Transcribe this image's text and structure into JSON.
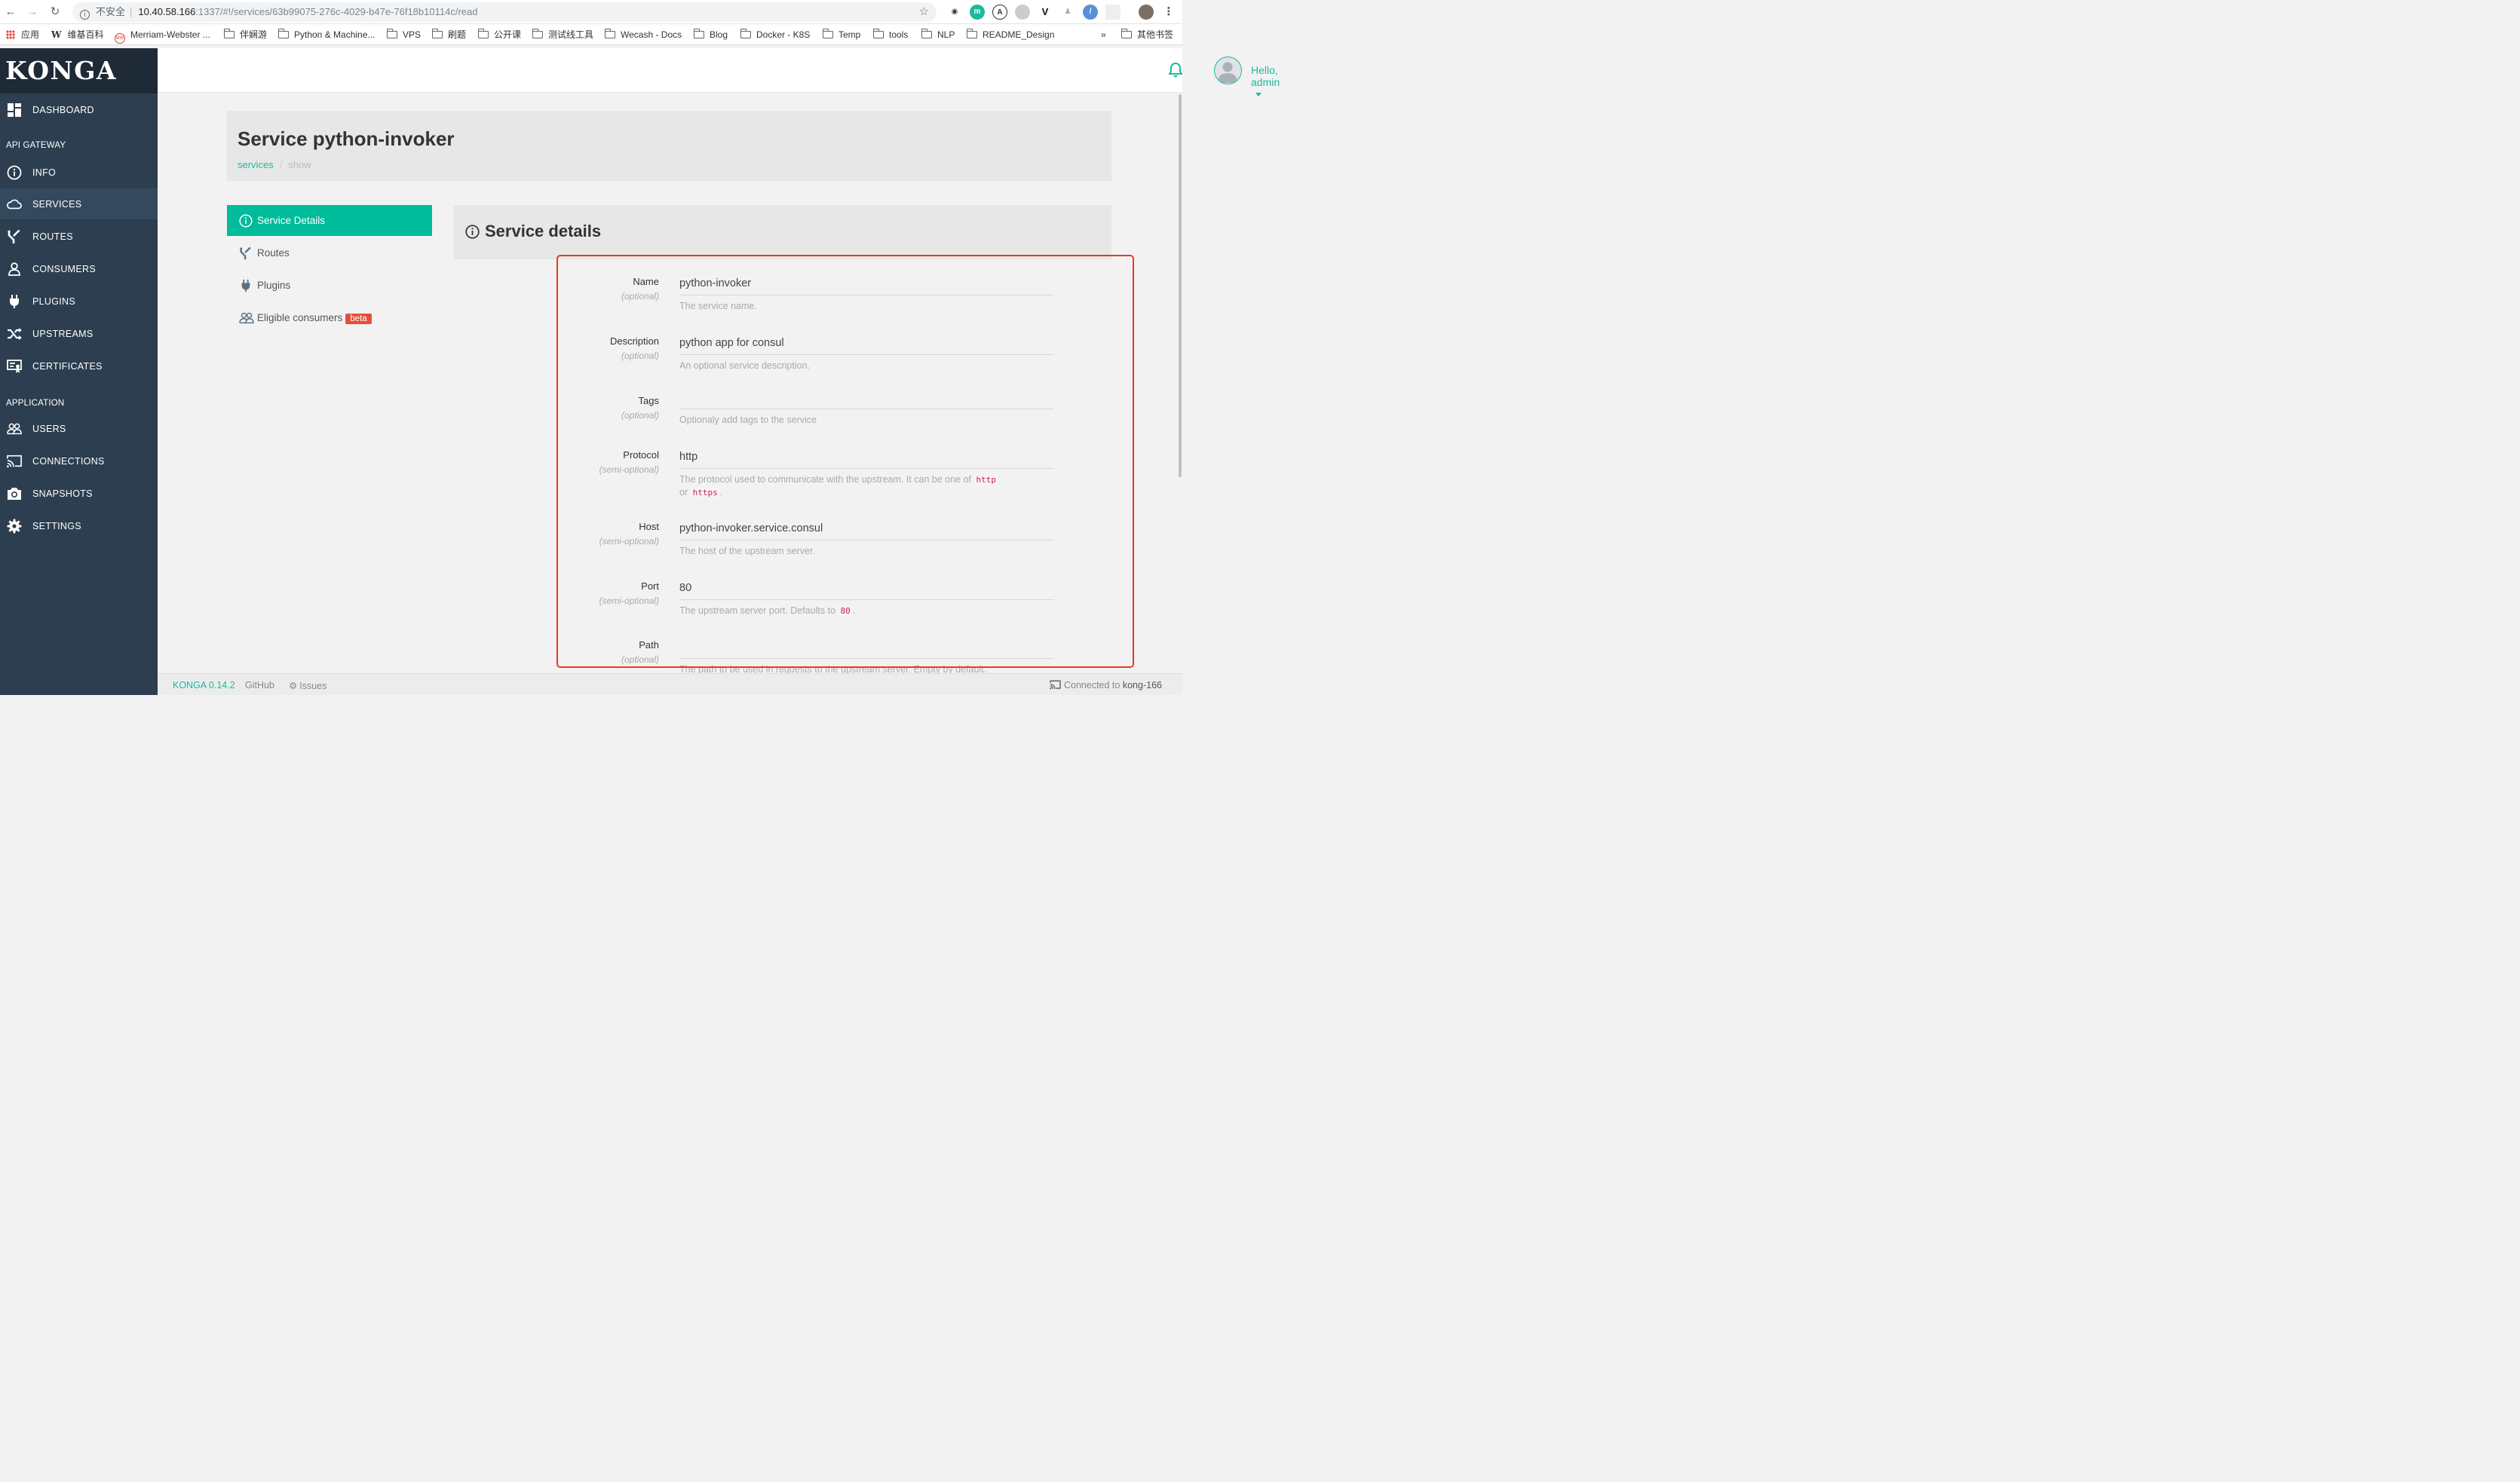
{
  "browser": {
    "insecure_label": "不安全",
    "url_host": "10.40.58.166",
    "url_path": ":1337/#!/services/63b99075-276c-4029-b47e-76f18b10114c/read"
  },
  "bookmarks": {
    "items": [
      "应用",
      "维基百科",
      "Merriam-Webster ...",
      "伴娴游",
      "Python & Machine...",
      "VPS",
      "刷题",
      "公开课",
      "测试线工具",
      "Wecash - Docs",
      "Blog",
      "Docker - K8S",
      "Temp",
      "tools",
      "NLP",
      "README_Design"
    ],
    "more": "»",
    "other": "其他书签"
  },
  "sidebar": {
    "logo": "KONGA",
    "dashboard": "DASHBOARD",
    "section_gateway": "API GATEWAY",
    "gateway_items": [
      "INFO",
      "SERVICES",
      "ROUTES",
      "CONSUMERS",
      "PLUGINS",
      "UPSTREAMS",
      "CERTIFICATES"
    ],
    "section_application": "APPLICATION",
    "app_items": [
      "USERS",
      "CONNECTIONS",
      "SNAPSHOTS",
      "SETTINGS"
    ],
    "active": "SERVICES"
  },
  "topbar": {
    "greeting": "Hello, admin"
  },
  "page": {
    "title": "Service python-invoker",
    "breadcrumb_link": "services",
    "breadcrumb_current": "show"
  },
  "tabs": {
    "items": [
      "Service Details",
      "Routes",
      "Plugins",
      "Eligible consumers"
    ],
    "beta": "beta",
    "active": "Service Details"
  },
  "details": {
    "title": "Service details",
    "fields": [
      {
        "label": "Name",
        "qualifier": "(optional)",
        "value": "python-invoker",
        "help": "The service name."
      },
      {
        "label": "Description",
        "qualifier": "(optional)",
        "value": "python app for consul",
        "help": "An optional service description."
      },
      {
        "label": "Tags",
        "qualifier": "(optional)",
        "value": "",
        "help": "Optionaly add tags to the service"
      },
      {
        "label": "Protocol",
        "qualifier": "(semi-optional)",
        "value": "http",
        "help_pre": "The protocol used to communicate with the upstream. It can be one of",
        "help_code1": "http",
        "help_mid": "or",
        "help_code2": "https",
        "help_post": "."
      },
      {
        "label": "Host",
        "qualifier": "(semi-optional)",
        "value": "python-invoker.service.consul",
        "help": "The host of the upstream server."
      },
      {
        "label": "Port",
        "qualifier": "(semi-optional)",
        "value": "80",
        "help_pre": "The upstream server port. Defaults to",
        "help_code1": "80",
        "help_post": "."
      },
      {
        "label": "Path",
        "qualifier": "(optional)",
        "value": "",
        "help": "The path to be used in requests to the upstream server. Empty by default."
      }
    ]
  },
  "footer": {
    "version": "KONGA 0.14.2",
    "github": "GitHub",
    "issues": "Issues",
    "connected_pre": "Connected to",
    "connection": "kong-166"
  },
  "colors": {
    "accent": "#1abc9c",
    "sidebar_bg": "#2c3e50",
    "highlight": "#ea3a24",
    "badge": "#e74c3c"
  }
}
